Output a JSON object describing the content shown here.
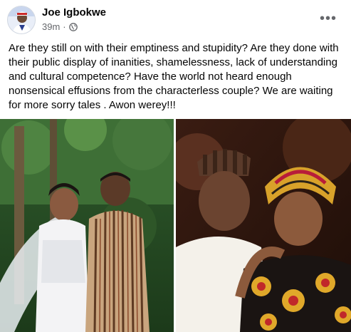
{
  "post": {
    "author": "Joe Igbokwe",
    "time": "39m",
    "separator": "·",
    "privacy_icon": "globe-icon",
    "more_icon": "more-horizontal-icon",
    "more_glyph": "•••",
    "text": "Are they still on with their emptiness and stupidity? Are they done with their public display of inanities,  shamelessness, lack of understanding and cultural competence? Have the world not heard enough nonsensical effusions from the characterless couple? We are waiting for more sorry tales . Awon werey!!!"
  },
  "colors": {
    "text": "#050505",
    "secondary": "#65676b"
  }
}
